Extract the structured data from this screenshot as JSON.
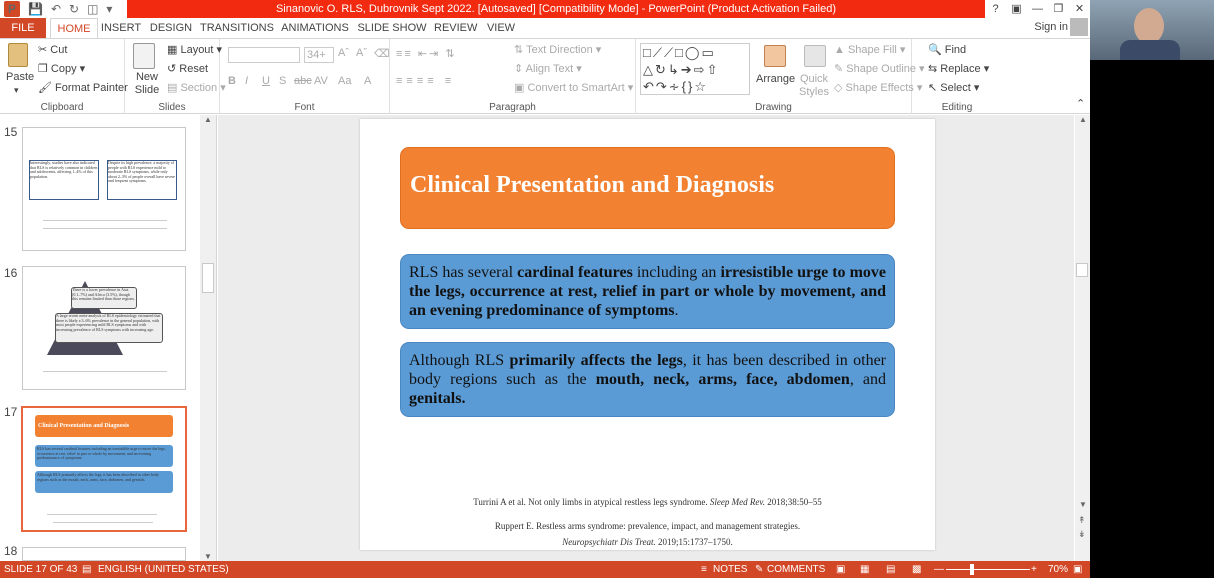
{
  "window": {
    "title": "Sinanovic O. RLS, Dubrovnik Sept 2022. [Autosaved] [Compatibility Mode] -  PowerPoint (Product Activation Failed)",
    "help": "?",
    "controls": [
      "minimize",
      "restore",
      "close"
    ]
  },
  "tabs": [
    {
      "label": "FILE",
      "active": false
    },
    {
      "label": "HOME",
      "active": true
    },
    {
      "label": "INSERT",
      "active": false
    },
    {
      "label": "DESIGN",
      "active": false
    },
    {
      "label": "TRANSITIONS",
      "active": false
    },
    {
      "label": "ANIMATIONS",
      "active": false
    },
    {
      "label": "SLIDE SHOW",
      "active": false
    },
    {
      "label": "REVIEW",
      "active": false
    },
    {
      "label": "VIEW",
      "active": false
    }
  ],
  "account": {
    "signin": "Sign in"
  },
  "ribbon": {
    "clipboard": {
      "paste": "Paste",
      "cut": "Cut",
      "copy": "Copy",
      "format_painter": "Format Painter",
      "label": "Clipboard"
    },
    "slides": {
      "new_slide": "New Slide",
      "layout": "Layout",
      "reset": "Reset",
      "section": "Section",
      "label": "Slides"
    },
    "font": {
      "font_size": "34+",
      "bold": "B",
      "italic": "I",
      "underline": "U",
      "shadow": "S",
      "strike": "abc",
      "spacing": "AV",
      "case": "Aa",
      "label": "Font"
    },
    "paragraph": {
      "text_direction": "Text Direction",
      "align_text": "Align Text",
      "convert_smartart": "Convert to SmartArt",
      "label": "Paragraph"
    },
    "drawing": {
      "arrange": "Arrange",
      "quick_styles": "Quick Styles",
      "shape_fill": "Shape Fill",
      "shape_outline": "Shape Outline",
      "shape_effects": "Shape Effects",
      "label": "Drawing"
    },
    "editing": {
      "find": "Find",
      "replace": "Replace",
      "select": "Select",
      "label": "Editing"
    }
  },
  "thumbnails": [
    {
      "number": "15",
      "left_text": "Interestingly, studies have also indicated that RLS is relatively common in children and adolescents, affecting 1–4% of this population.",
      "right_text": "Despite its high prevalence, a majority of people with RLS experience mild to moderate RLS symptoms, while only about 2–3% of people overall have severe and frequent symptoms."
    },
    {
      "number": "16",
      "top_text": "There is a lower prevalence in Asia (0.1–7%) and Africa (3.5%), though this remains limited than those regions.",
      "bottom_text": "A large recent meta-analysis of RLS epidemiology estimated that there is likely a 3–6% prevalence in the general population, with most people experiencing mild RLS symptoms and with increasing prevalence of RLS symptoms with increasing age."
    },
    {
      "number": "17",
      "title": "Clinical Presentation and Diagnosis",
      "b1": "RLS has several cardinal features including an irresistible urge to move the legs, occurrence at rest, relief in part or whole by movement, and an evening predominance of symptoms.",
      "b2": "Although RLS primarily affects the legs, it has been described in other body regions such as the mouth, neck, arms, face, abdomen, and genitals."
    },
    {
      "number": "18"
    }
  ],
  "slide": {
    "title": "Clinical Presentation and Diagnosis",
    "box1": {
      "t1": "RLS has several ",
      "b1": "cardinal features",
      "t2": " including an ",
      "b2": "irresistible urge to move the legs, occurrence at rest, relief in part or whole by movement, and an evening predominance of symptoms",
      "t3": "."
    },
    "box2": {
      "t1": "Although RLS ",
      "b1": "primarily affects the legs",
      "t2": ", it has been described in other body regions such as the ",
      "b2": "mouth, neck, arms, face, abdomen",
      "t3": ", and ",
      "b3": "genitals."
    },
    "ref1": {
      "text": "Turrini A et al. Not only limbs in atypical restless legs syndrome. ",
      "journal": "Sleep Med Rev.",
      "tail": " 2018;38:50–55"
    },
    "ref2": {
      "line1": "Ruppert E. Restless arms syndrome: prevalence, impact, and management strategies.",
      "journal": "Neuropsychiatr Dis Treat.",
      "tail": " 2019;15:1737–1750."
    }
  },
  "status": {
    "slide_counter": "SLIDE 17 OF 43",
    "language": "ENGLISH (UNITED STATES)",
    "notes": "NOTES",
    "comments": "COMMENTS",
    "zoom": "70%"
  },
  "colors": {
    "accent": "#d24726",
    "title_bar": "#f22a10",
    "slide_orange": "#f28232",
    "slide_blue": "#5b9bd5"
  }
}
